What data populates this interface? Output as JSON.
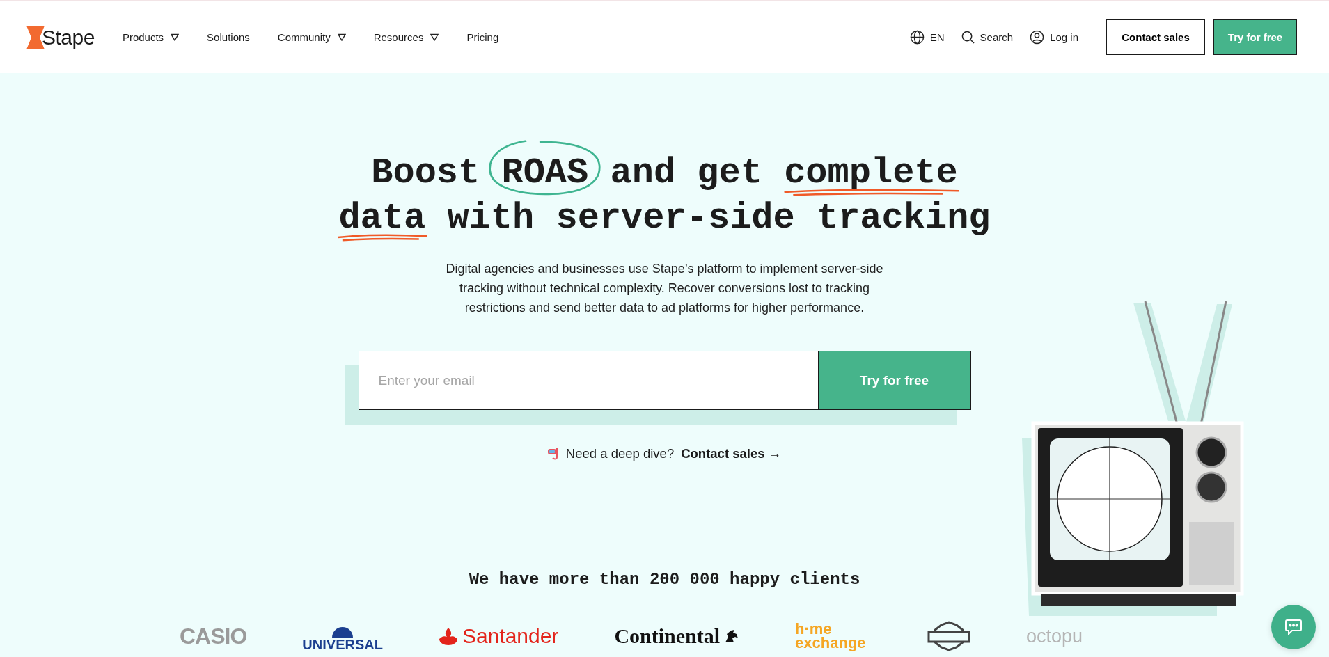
{
  "header": {
    "logo": "Stape",
    "nav": [
      {
        "label": "Products",
        "dropdown": true
      },
      {
        "label": "Solutions",
        "dropdown": false
      },
      {
        "label": "Community",
        "dropdown": true
      },
      {
        "label": "Resources",
        "dropdown": true
      },
      {
        "label": "Pricing",
        "dropdown": false
      }
    ],
    "language": "EN",
    "search": "Search",
    "login": "Log in",
    "contact_button": "Contact sales",
    "trial_button": "Try for free"
  },
  "hero": {
    "headline": [
      [
        {
          "text": "Boost ",
          "circled": false,
          "underlined": false
        },
        {
          "text": "ROAS",
          "circled": true,
          "underlined": false
        },
        {
          "text": " and get ",
          "circled": false,
          "underlined": false
        },
        {
          "text": "complete",
          "circled": false,
          "underlined": true
        }
      ],
      [
        {
          "text": "data",
          "circled": false,
          "underlined": true
        },
        {
          "text": " with server-side tracking",
          "circled": false,
          "underlined": false
        }
      ]
    ],
    "description": "Digital agencies and businesses use Stape’s platform to implement server-side tracking without technical complexity. Recover conversions lost to tracking restrictions and send better data to ad platforms for higher performance.",
    "email": {
      "placeholder": "Enter your email"
    },
    "submit_button": "Try for free",
    "deep_dive": {
      "text": "Need a deep dive?",
      "link": "Contact sales →"
    },
    "illustration": {
      "kind": "picture"
    }
  },
  "clients": {
    "heading": "We have more than 200 000 happy clients",
    "logos": [
      {
        "kind": "wordmark",
        "text": "CASIO",
        "color": "#9a9a9a"
      },
      {
        "kind": "globe-wordmark",
        "text": "UNIVERSAL",
        "color": "#1b3f8f"
      },
      {
        "kind": "flame-wordmark",
        "text": "Santander",
        "color": "#e3241b"
      },
      {
        "kind": "horse-wordmark",
        "text": "Continental",
        "color": "#111111"
      },
      {
        "kind": "wordmark",
        "text": "h·me exchange",
        "color": "#f5a623"
      },
      {
        "kind": "shield"
      },
      {
        "kind": "wordmark",
        "text": "octopu",
        "color": "#b5b5b5"
      }
    ]
  }
}
